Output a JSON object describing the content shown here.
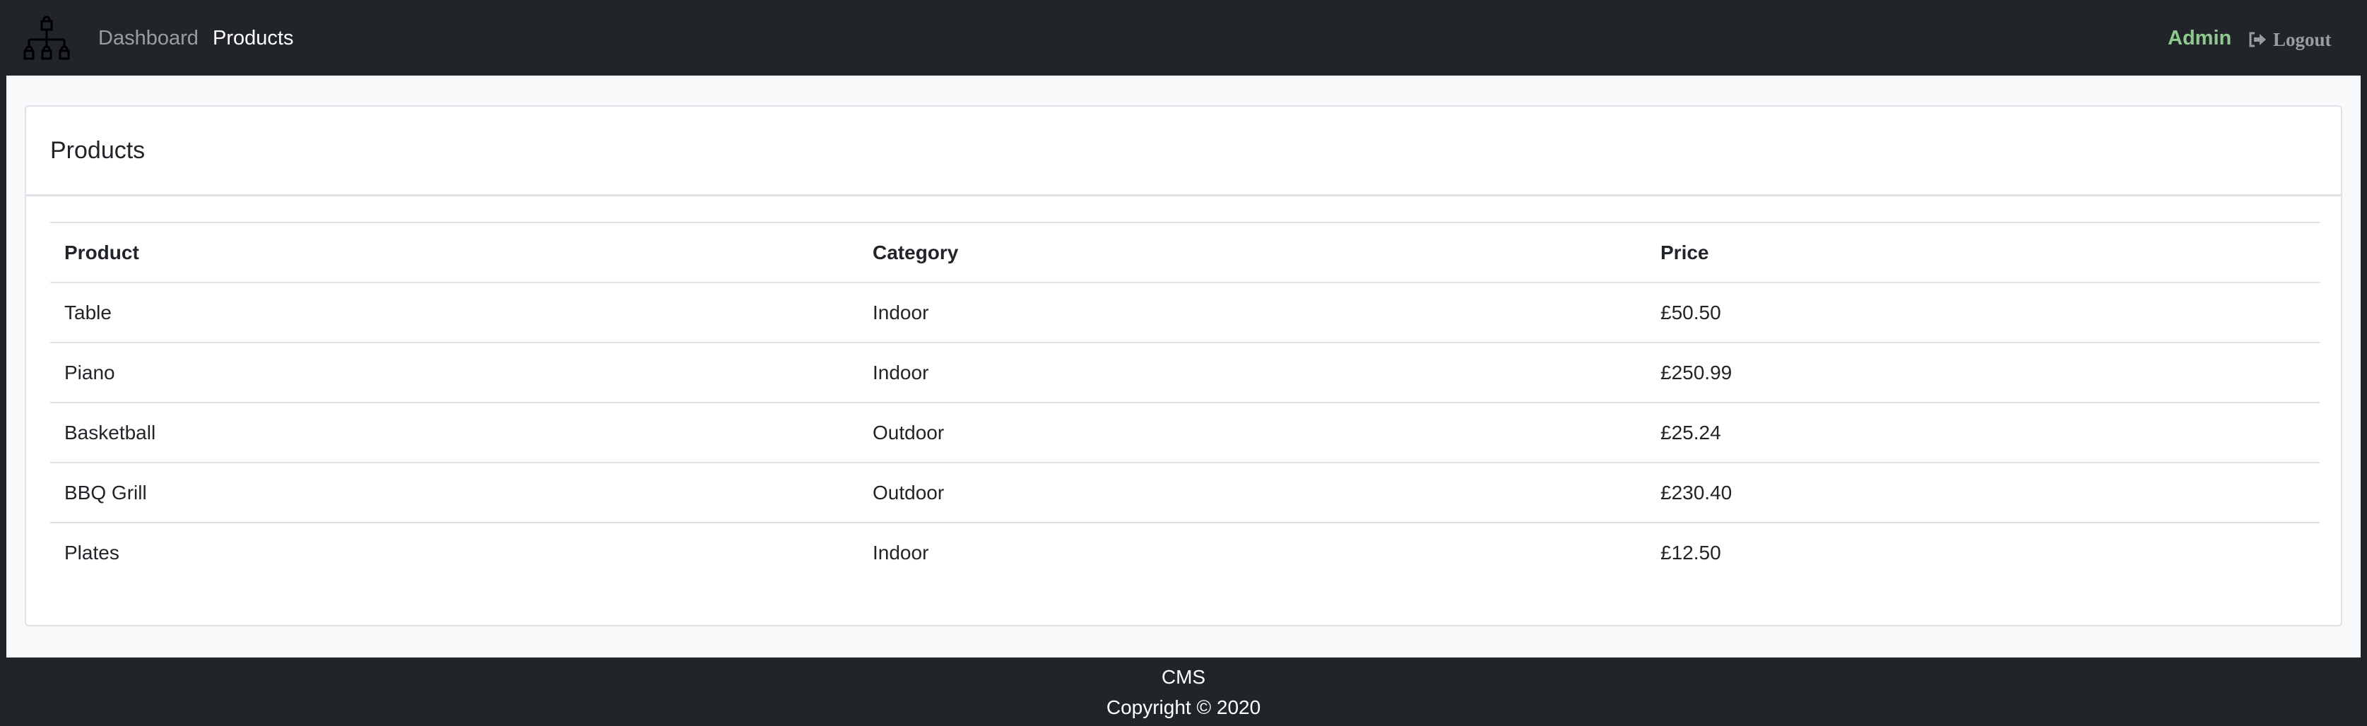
{
  "navbar": {
    "brand_icon": "sitemap-icon",
    "links": [
      {
        "label": "Dashboard",
        "active": false
      },
      {
        "label": "Products",
        "active": true
      }
    ],
    "user": "Admin",
    "logout_label": "Logout",
    "logout_icon": "sign-out-icon",
    "colors": {
      "background": "#212529",
      "user": "#8fc98f"
    }
  },
  "main": {
    "card_title": "Products",
    "table": {
      "headers": [
        "Product",
        "Category",
        "Price"
      ],
      "rows": [
        [
          "Table",
          "Indoor",
          "£50.50"
        ],
        [
          "Piano",
          "Indoor",
          "£250.99"
        ],
        [
          "Basketball",
          "Outdoor",
          "£25.24"
        ],
        [
          "BBQ Grill",
          "Outdoor",
          "£230.40"
        ],
        [
          "Plates",
          "Indoor",
          "£12.50"
        ]
      ]
    }
  },
  "footer": {
    "line1": "CMS",
    "line2": "Copyright © 2020"
  }
}
